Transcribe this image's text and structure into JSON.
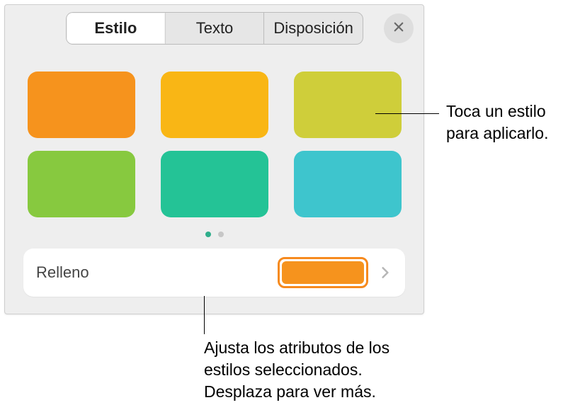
{
  "tabs": {
    "style": "Estilo",
    "text": "Texto",
    "layout": "Disposición"
  },
  "close_icon": "close",
  "swatches": [
    {
      "name": "swatch-orange",
      "color": "#f6931d"
    },
    {
      "name": "swatch-amber",
      "color": "#f9b615"
    },
    {
      "name": "swatch-olive",
      "color": "#cfce3a"
    },
    {
      "name": "swatch-green",
      "color": "#87c93f"
    },
    {
      "name": "swatch-teal",
      "color": "#24c396"
    },
    {
      "name": "swatch-cyan",
      "color": "#3ec5cd"
    }
  ],
  "pager": {
    "pages": 2,
    "active": 0
  },
  "fill": {
    "label": "Relleno",
    "color": "#f6931d"
  },
  "callouts": {
    "top": "Toca un estilo para aplicarlo.",
    "bottom": "Ajusta los atributos de los estilos seleccionados. Desplaza para ver más."
  }
}
